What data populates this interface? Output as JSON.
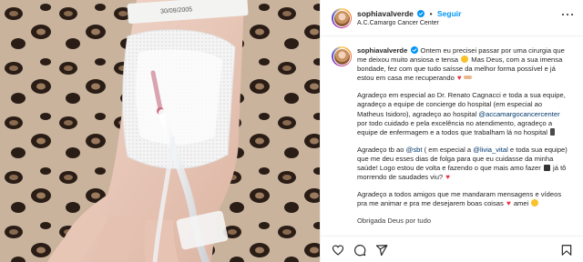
{
  "post": {
    "username": "sophiavalverde",
    "follow_label": "Seguir",
    "separator": "•",
    "location": "A.C.Camargo Cancer Center",
    "wristband_text": "30/09/2005",
    "more_icon": "more-horizontal-icon"
  },
  "caption": {
    "username": "sophiavalverde",
    "p1_a": "Ontem eu precisei passar por uma cirurgia que me deixou muito ansiosa e tensa",
    "p1_b": "Mas Deus, com a sua imensa bondade, fez com que tudo saísse da melhor forma possível e já estou em casa me recuperando",
    "p2_a": "Agradeço em especial ao Dr. Renato Cagnacci e toda a sua equipe, agradeço a equipe de concierge do hospital (em especial ao Matheus Isidoro), agradeço ao hospital",
    "p2_mention": "@accamargocancercenter",
    "p2_b": "por todo cuidado e pela excelência no atendimento, agradeço a equipe de enfermagem e a todos que trabalham lá no hospital",
    "p3_a": "Agradeço tb ao",
    "p3_mention1": "@sbt",
    "p3_b": "( em especial a",
    "p3_mention2": "@livia_vital",
    "p3_c": "e toda sua equipe) que me deu esses dias de folga para que eu cuidasse da minha saúde! Logo estou de volta e fazendo o que mais amo fazer",
    "p3_d": "já tô morrendo de saudades viu?",
    "p4_a": "Agradeço a todos amigos que me mandaram mensagens e vídeos pra me animar e pra me desejarem boas coisas",
    "p4_b": "amei",
    "p5_cut": "Obrigada Deus por tudo"
  },
  "actions": {
    "icons": [
      "heart-icon",
      "comment-icon",
      "share-icon",
      "bookmark-icon"
    ]
  },
  "colors": {
    "link_blue": "#0095f6",
    "mention": "#00376b",
    "text": "#262626",
    "heart_red": "#ed2e3d"
  }
}
